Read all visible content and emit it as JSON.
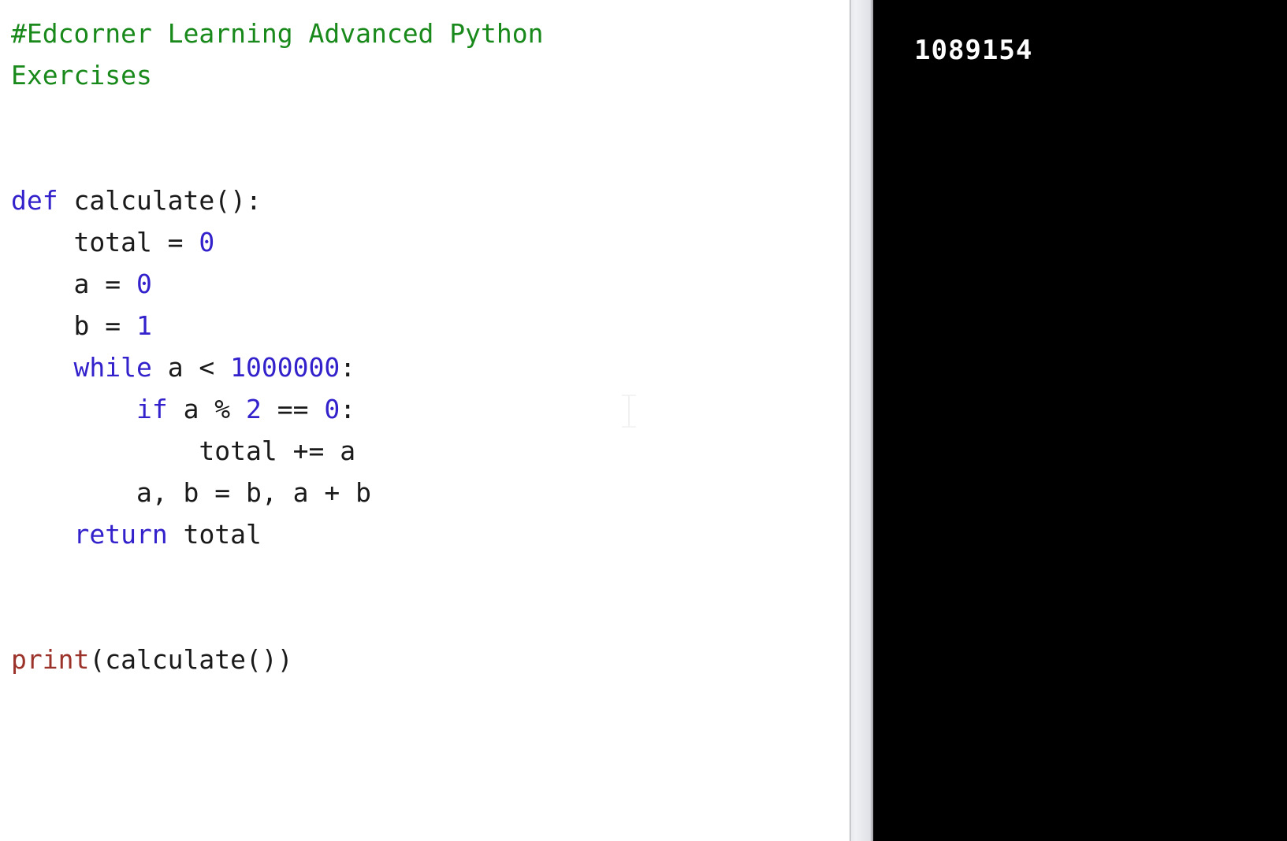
{
  "editor": {
    "language": "python",
    "colors": {
      "background": "#ffffff",
      "comment": "#18891a",
      "keyword": "#3322cc",
      "number": "#3322cc",
      "builtin": "#9c332b",
      "plain": "#1a1a1a"
    },
    "cursor_icon": "text-ibeam-cursor",
    "code_lines": [
      {
        "indent": 0,
        "tokens": [
          {
            "type": "comment",
            "text": "#Edcorner Learning Advanced Python"
          }
        ]
      },
      {
        "indent": 0,
        "tokens": [
          {
            "type": "comment",
            "text": "Exercises"
          }
        ]
      },
      {
        "indent": 0,
        "tokens": []
      },
      {
        "indent": 0,
        "tokens": []
      },
      {
        "indent": 0,
        "tokens": [
          {
            "type": "keyword",
            "text": "def"
          },
          {
            "type": "plain",
            "text": " calculate():"
          }
        ]
      },
      {
        "indent": 0,
        "tokens": [
          {
            "type": "plain",
            "text": "    total = "
          },
          {
            "type": "number",
            "text": "0"
          }
        ]
      },
      {
        "indent": 0,
        "tokens": [
          {
            "type": "plain",
            "text": "    a = "
          },
          {
            "type": "number",
            "text": "0"
          }
        ]
      },
      {
        "indent": 0,
        "tokens": [
          {
            "type": "plain",
            "text": "    b = "
          },
          {
            "type": "number",
            "text": "1"
          }
        ]
      },
      {
        "indent": 0,
        "tokens": [
          {
            "type": "plain",
            "text": "    "
          },
          {
            "type": "keyword",
            "text": "while"
          },
          {
            "type": "plain",
            "text": " a < "
          },
          {
            "type": "number",
            "text": "1000000"
          },
          {
            "type": "plain",
            "text": ":"
          }
        ]
      },
      {
        "indent": 0,
        "tokens": [
          {
            "type": "plain",
            "text": "        "
          },
          {
            "type": "keyword",
            "text": "if"
          },
          {
            "type": "plain",
            "text": " a % "
          },
          {
            "type": "number",
            "text": "2"
          },
          {
            "type": "plain",
            "text": " == "
          },
          {
            "type": "number",
            "text": "0"
          },
          {
            "type": "plain",
            "text": ":"
          }
        ]
      },
      {
        "indent": 0,
        "tokens": [
          {
            "type": "plain",
            "text": "            total += a"
          }
        ]
      },
      {
        "indent": 0,
        "tokens": [
          {
            "type": "plain",
            "text": "        a, b = b, a + b"
          }
        ]
      },
      {
        "indent": 0,
        "tokens": [
          {
            "type": "plain",
            "text": "    "
          },
          {
            "type": "keyword",
            "text": "return"
          },
          {
            "type": "plain",
            "text": " total"
          }
        ]
      },
      {
        "indent": 0,
        "tokens": []
      },
      {
        "indent": 0,
        "tokens": []
      },
      {
        "indent": 0,
        "tokens": [
          {
            "type": "builtin",
            "text": "print"
          },
          {
            "type": "plain",
            "text": "(calculate())"
          }
        ]
      }
    ],
    "plain_source": "#Edcorner Learning Advanced Python\nExercises\n\n\ndef calculate():\n    total = 0\n    a = 0\n    b = 1\n    while a < 1000000:\n        if a % 2 == 0:\n            total += a\n        a, b = b, a + b\n    return total\n\n\nprint(calculate())"
  },
  "console": {
    "background": "#000000",
    "text_color": "#fdfdfd",
    "lines": [
      "1089154"
    ],
    "output": "1089154"
  },
  "divider": {
    "role": "vertical-scrollbar-divider",
    "color": "#e6e8ec"
  }
}
